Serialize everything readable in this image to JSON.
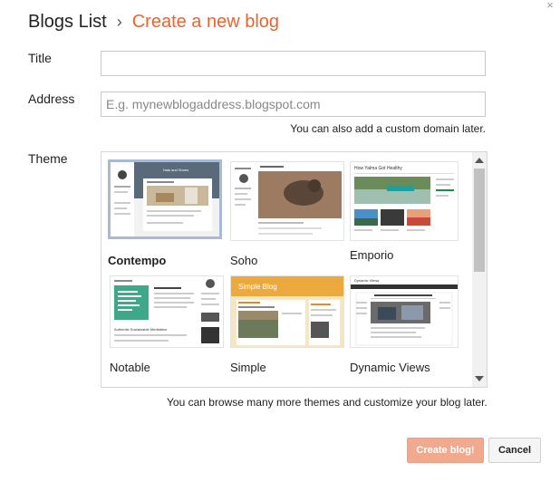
{
  "header": {
    "breadcrumb": "Blogs List",
    "separator": "›",
    "title": "Create a new blog"
  },
  "form": {
    "title_label": "Title",
    "title_value": "",
    "address_label": "Address",
    "address_placeholder": "E.g. mynewblogaddress.blogspot.com",
    "address_hint": "You can also add a custom domain later.",
    "theme_label": "Theme",
    "themes_hint": "You can browse many more themes and customize your blog later."
  },
  "themes": [
    {
      "name": "Contempo",
      "selected": true
    },
    {
      "name": "Soho",
      "selected": false
    },
    {
      "name": "Emporio",
      "selected": false
    },
    {
      "name": "Notable",
      "selected": false
    },
    {
      "name": "Simple",
      "selected": false
    },
    {
      "name": "Dynamic Views",
      "selected": false
    }
  ],
  "previews": {
    "contempo_header": "Hats and Shoes",
    "emporio_header": "How Yalma Got Healthy",
    "notable_header": "Authentic Sustainable Meditation",
    "simple_header": "Simple Blog",
    "dynamic_header": "Dynamic Views"
  },
  "buttons": {
    "create": "Create blog!",
    "cancel": "Cancel"
  },
  "colors": {
    "accent": "#e8652f",
    "create_button": "#f2aa8f",
    "selected_border": "#a9bad4"
  }
}
